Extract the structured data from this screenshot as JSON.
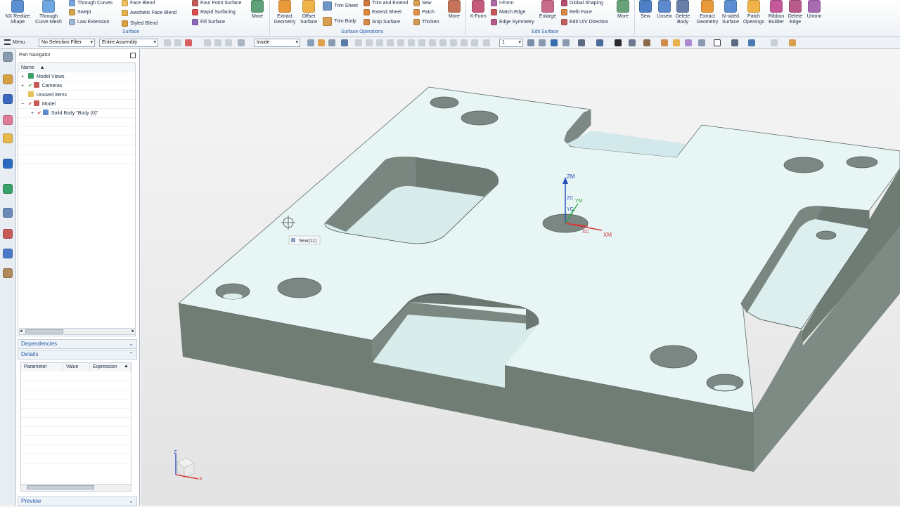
{
  "ribbon": {
    "left": {
      "nx_realize_shape": "NX Realize\nShape",
      "through_curve_mesh": "Through\nCurve Mesh",
      "through_curves": "Through Curves",
      "swept": "Swept",
      "law_extension": "Law Extension",
      "face_blend": "Face Blend",
      "aesthetic_face_blend": "Aesthetic Face Blend",
      "styled_blend": "Styled Blend",
      "four_point_surface": "Four Point Surface",
      "rapid_surfacing": "Rapid Surfacing",
      "fill_surface": "Fill Surface",
      "more": "More",
      "group_label": "Surface"
    },
    "surface_operations": {
      "extract_geometry": "Extract\nGeometry",
      "offset_surface": "Offset\nSurface",
      "trim_sheet": "Trim Sheet",
      "trim_body": "Trim Body",
      "trim_and_extend": "Trim and Extend",
      "extend_sheet": "Extend Sheet",
      "snip_surface": "Snip Surface",
      "sew": "Sew",
      "patch": "Patch",
      "thicken": "Thicken",
      "more": "More",
      "group_label": "Surface Operations"
    },
    "edit_surface": {
      "x_form": "X-Form",
      "i_form": "I-Form",
      "match_edge": "Match Edge",
      "edge_symmetry": "Edge Symmetry",
      "enlarge": "Enlarge",
      "global_shaping": "Global Shaping",
      "refit_face": "Refit Face",
      "edit_uv_direction": "Edit U/V Direction",
      "more": "More",
      "group_label": "Edit Surface"
    },
    "right": {
      "sew": "Sew",
      "unsew": "Unsew",
      "delete_body": "Delete\nBody",
      "extract_geometry": "Extract\nGeometry",
      "n_sided_surface": "N-sided\nSurface",
      "patch_openings": "Patch\nOpenings",
      "ribbon_builder": "Ribbon\nBuilder",
      "delete_edge": "Delete\nEdge",
      "untrim": "Untrim"
    }
  },
  "toolbar": {
    "menu_label": "Menu",
    "selection_filter": "No Selection Filter",
    "assembly_scope": "Entire Assembly",
    "inside_option": "Inside",
    "layer_value": "1"
  },
  "navigator": {
    "title": "Part Navigator",
    "column_name": "Name",
    "items": [
      {
        "label": "Model Views"
      },
      {
        "label": "Cameras"
      },
      {
        "label": "Unused Items"
      },
      {
        "label": "Model"
      },
      {
        "label": "Solid Body \"Body (0)\""
      }
    ],
    "dependencies": "Dependencies",
    "details": "Details",
    "details_columns": [
      "Parameter",
      "Value",
      "Expression"
    ],
    "preview": "Preview"
  },
  "viewport": {
    "cursor_label": "Sew(11)",
    "csys": {
      "zm": "ZM",
      "xm": "XM",
      "zc": "ZC",
      "yc": "YC",
      "ym": "YM",
      "xc": "XC"
    },
    "triad": {
      "z": "Z",
      "x": "X"
    }
  },
  "colors": {
    "accent": "#2b5ea8",
    "top_face": "#e9f6f5",
    "side_face": "#6f7d75",
    "pocket_wall": "#7d8a84"
  }
}
